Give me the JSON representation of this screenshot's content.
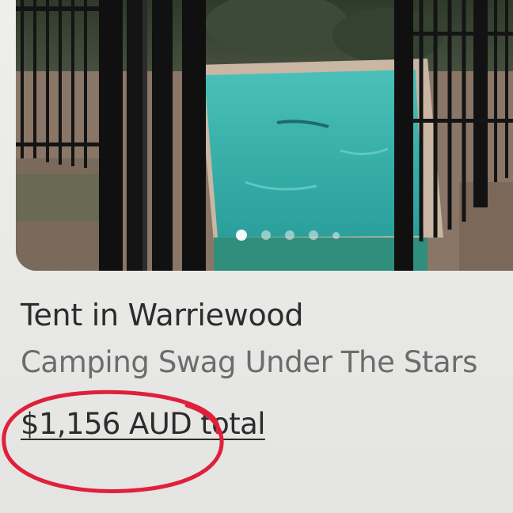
{
  "listing": {
    "title": "Tent in Warriewood",
    "subtitle": "Camping Swag Under The Stars",
    "price": "$1,156 AUD total"
  },
  "photo": {
    "subject": "pool-behind-black-fence",
    "carousel_dots": 5,
    "active_dot": 0
  },
  "annotation": {
    "type": "hand-drawn-circle",
    "color": "#e0203a",
    "target": "price"
  },
  "colors": {
    "pool": "#34b3ae",
    "fence": "#121212",
    "title_text": "#2c2c2c",
    "subtitle_text": "#6c6c6c"
  }
}
